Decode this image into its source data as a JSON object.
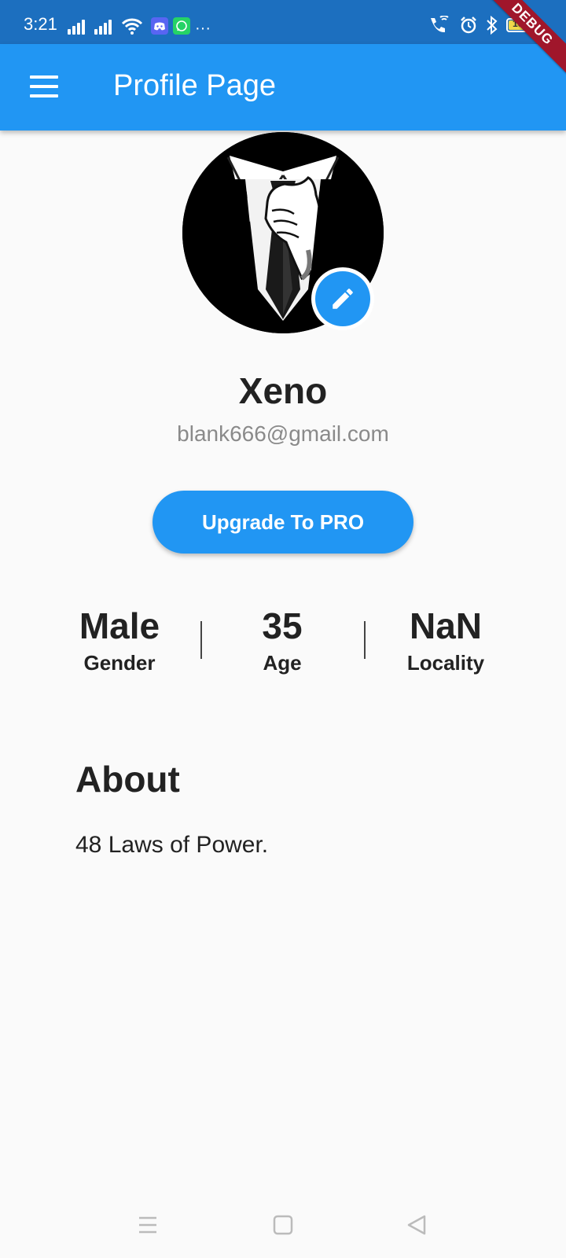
{
  "status_bar": {
    "time": "3:21",
    "battery": "100",
    "icons": [
      "signal-icon",
      "signal-icon",
      "wifi-icon",
      "discord-icon",
      "whatsapp-icon",
      "more-icon",
      "wifi-call-icon",
      "alarm-icon",
      "bluetooth-icon",
      "battery-icon"
    ]
  },
  "debug_banner": "DEBUG",
  "app_bar": {
    "title": "Profile Page",
    "menu_icon": "menu-icon"
  },
  "profile": {
    "name": "Xeno",
    "email": "blank666@gmail.com",
    "edit_icon": "pencil-icon"
  },
  "upgrade_button": "Upgrade To PRO",
  "stats": [
    {
      "value": "Male",
      "label": "Gender"
    },
    {
      "value": "35",
      "label": "Age"
    },
    {
      "value": "NaN",
      "label": "Locality"
    }
  ],
  "about": {
    "title": "About",
    "text": "48 Laws of Power."
  },
  "nav_bar": {
    "icons": [
      "menu-lines-icon",
      "home-square-icon",
      "back-triangle-icon"
    ]
  },
  "colors": {
    "primary": "#2196f3",
    "status_bar": "#1c6fbf",
    "background": "#fafafa",
    "debug": "#a0162b"
  }
}
